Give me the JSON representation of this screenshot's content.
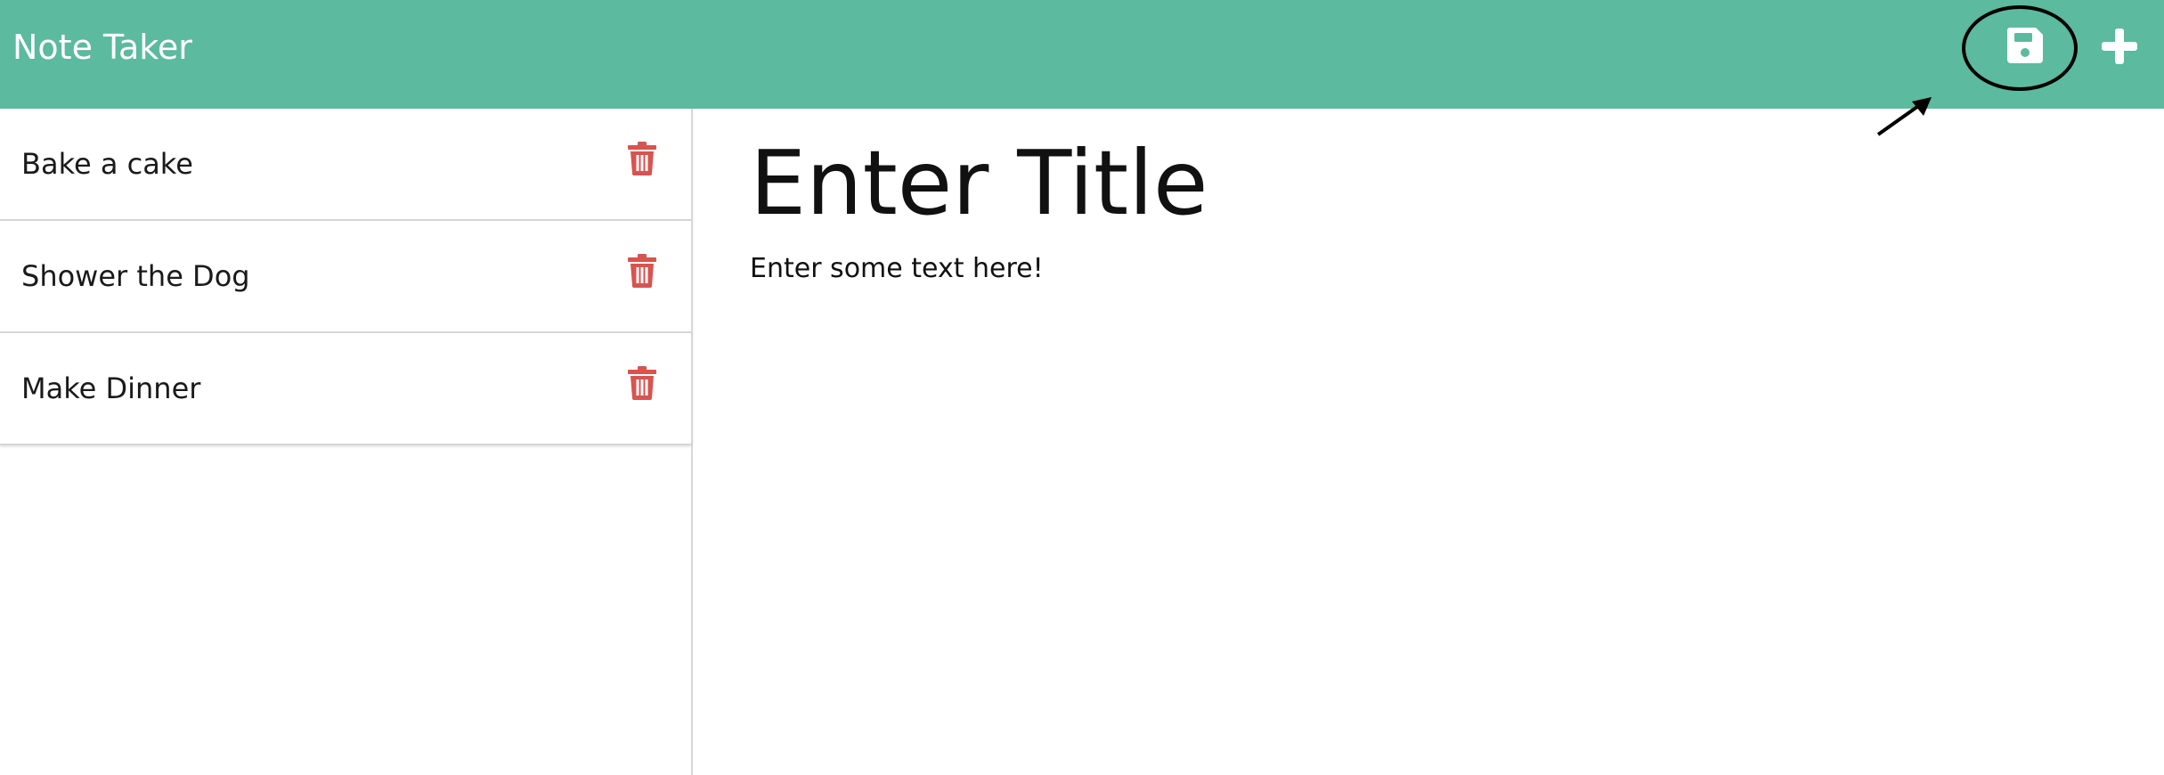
{
  "app": {
    "title": "Note Taker",
    "accent_color": "#5cba9e",
    "delete_color": "#d9534f"
  },
  "toolbar": {
    "save_icon": "save-icon",
    "add_icon": "plus-icon"
  },
  "notes": [
    {
      "title": "Bake a cake",
      "icon": "trash-icon"
    },
    {
      "title": "Shower the Dog",
      "icon": "trash-icon"
    },
    {
      "title": "Make Dinner",
      "icon": "trash-icon"
    }
  ],
  "editor": {
    "title_placeholder": "Enter Title",
    "text_placeholder": "Enter some text here!"
  }
}
